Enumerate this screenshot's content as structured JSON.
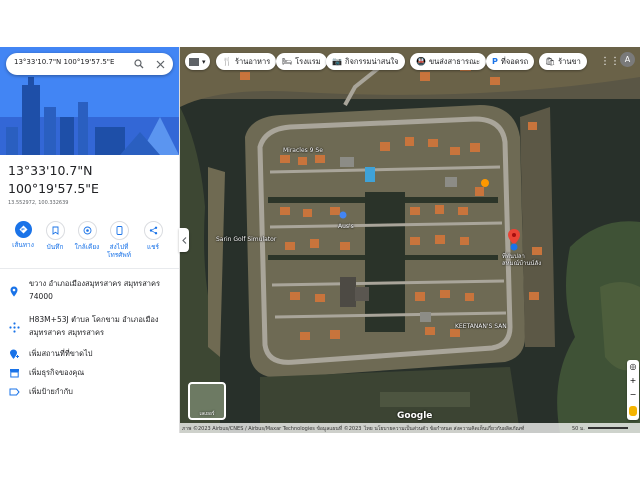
{
  "search": {
    "query": "13°33'10.7\"N 100°19'57.5\"E"
  },
  "place": {
    "lat": "13°33'10.7\"N",
    "lng": "100°19'57.5\"E",
    "decimal": "13.552972, 100.332639"
  },
  "actions": [
    {
      "label": "เส้นทาง",
      "icon": "directions-icon"
    },
    {
      "label": "บันทึก",
      "icon": "bookmark-icon"
    },
    {
      "label": "ใกล้เคียง",
      "icon": "nearby-icon"
    },
    {
      "label": "ส่งไปที่\nโทรศัพท์",
      "icon": "phone-icon"
    },
    {
      "label": "แชร์",
      "icon": "share-icon"
    }
  ],
  "info": {
    "address": "ขวาง อำเภอเมืองสมุทรสาคร สมุทรสาคร 74000",
    "pluscode": "H83M+53J ตำบล โคกขาม อำเภอเมืองสมุทรสาคร สมุทรสาคร",
    "add_missing": "เพิ่มสถานที่ที่ขาดไป",
    "add_business": "เพิ่มธุรกิจของคุณ",
    "add_label": "เพิ่มป้ายกำกับ"
  },
  "chips": [
    {
      "label": "ร้านอาหาร",
      "icon": "restaurant-icon"
    },
    {
      "label": "โรงแรม",
      "icon": "hotel-icon"
    },
    {
      "label": "กิจกรรมน่าสนใจ",
      "icon": "camera-icon"
    },
    {
      "label": "ขนส่งสาธารณะ",
      "icon": "transit-icon"
    },
    {
      "label": "ที่จอดรถ",
      "icon": "parking-icon"
    },
    {
      "label": "ร้านขา",
      "icon": "shopping-icon"
    }
  ],
  "map_labels": {
    "miracles": "Miracles 9 Se",
    "aus": "Aus's",
    "sarin": "Sarin Golf Simulator",
    "keetanan": "KEETANAN'S SAN",
    "thai_label": "ที่พันปลา\nสหมณ์บ้านน์ลัง"
  },
  "layers_label": "เลเยอร์",
  "footer": {
    "imagery": "ภาพ ©2023 Airbus/CNES / Airbus/Maxar Technologies ข้อมูลแผนที่ ©2023",
    "links": "ไทย  นโยบายความเป็นส่วนตัว  ข้อกำหนด  ส่งความคิดเห็นเกี่ยวกับผลิตภัณฑ์",
    "scale": "50 ม."
  },
  "google": "Google",
  "colors": {
    "primary": "#1a73e8",
    "pin": "#ea4335"
  }
}
